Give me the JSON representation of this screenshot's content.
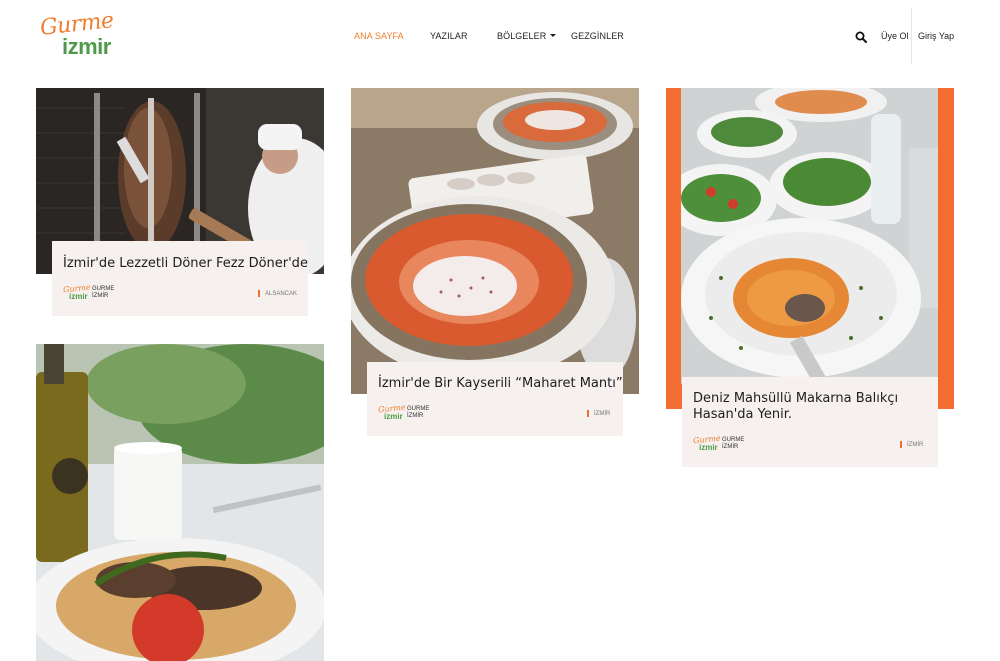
{
  "brand": {
    "line1": "Gurme",
    "line2": "izmir"
  },
  "nav": {
    "home": "ANA SAYFA",
    "posts": "YAZILAR",
    "regions": "BÖLGELER",
    "travelers": "GEZGİNLER"
  },
  "auth": {
    "signup": "Üye Ol",
    "login": "Giriş Yap"
  },
  "colors": {
    "accent": "#ef7d2d",
    "brand_green": "#4e9a4a",
    "card_bg": "#f6f1ee",
    "orange_frame": "#f36c32"
  },
  "icons": {
    "search": "search-icon",
    "dropdown": "chevron-down-icon"
  },
  "posts": [
    {
      "title": "İzmir'de Lezzetli Döner Fezz Döner'de",
      "author_line1": "GURME",
      "author_line2": "İZMİR",
      "region": "ALSANCAK"
    },
    {
      "title": "İzmir'de Bir Kayserili “Maharet Mantı”",
      "author_line1": "GURME",
      "author_line2": "İZMİR",
      "region": "İZMİR"
    },
    {
      "title_line1": "Deniz Mahsüllü Makarna Balıkçı",
      "title_line2": "Hasan'da Yenir.",
      "author_line1": "GURME",
      "author_line2": "İZMİR",
      "region": "İZMİR"
    }
  ]
}
